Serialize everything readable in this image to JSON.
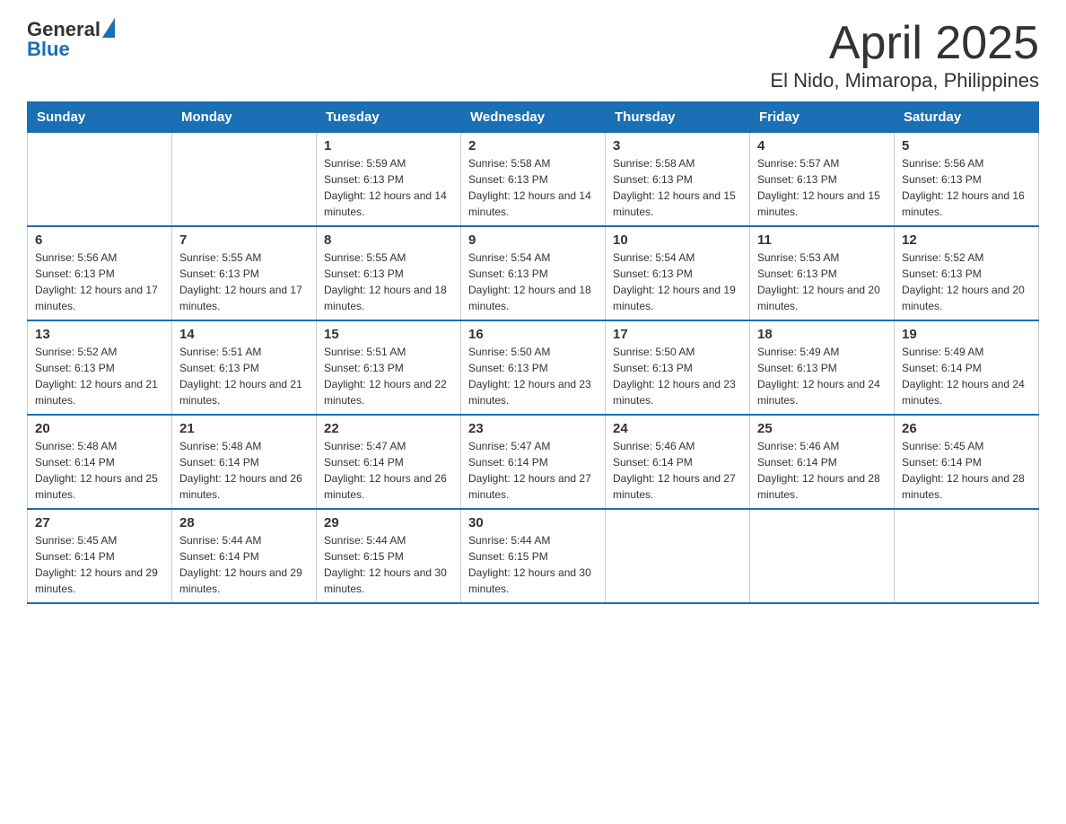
{
  "header": {
    "logo": {
      "general": "General",
      "blue": "Blue"
    },
    "title": "April 2025",
    "subtitle": "El Nido, Mimaropa, Philippines"
  },
  "weekdays": [
    "Sunday",
    "Monday",
    "Tuesday",
    "Wednesday",
    "Thursday",
    "Friday",
    "Saturday"
  ],
  "weeks": [
    [
      {
        "day": "",
        "sunrise": "",
        "sunset": "",
        "daylight": ""
      },
      {
        "day": "",
        "sunrise": "",
        "sunset": "",
        "daylight": ""
      },
      {
        "day": "1",
        "sunrise": "Sunrise: 5:59 AM",
        "sunset": "Sunset: 6:13 PM",
        "daylight": "Daylight: 12 hours and 14 minutes."
      },
      {
        "day": "2",
        "sunrise": "Sunrise: 5:58 AM",
        "sunset": "Sunset: 6:13 PM",
        "daylight": "Daylight: 12 hours and 14 minutes."
      },
      {
        "day": "3",
        "sunrise": "Sunrise: 5:58 AM",
        "sunset": "Sunset: 6:13 PM",
        "daylight": "Daylight: 12 hours and 15 minutes."
      },
      {
        "day": "4",
        "sunrise": "Sunrise: 5:57 AM",
        "sunset": "Sunset: 6:13 PM",
        "daylight": "Daylight: 12 hours and 15 minutes."
      },
      {
        "day": "5",
        "sunrise": "Sunrise: 5:56 AM",
        "sunset": "Sunset: 6:13 PM",
        "daylight": "Daylight: 12 hours and 16 minutes."
      }
    ],
    [
      {
        "day": "6",
        "sunrise": "Sunrise: 5:56 AM",
        "sunset": "Sunset: 6:13 PM",
        "daylight": "Daylight: 12 hours and 17 minutes."
      },
      {
        "day": "7",
        "sunrise": "Sunrise: 5:55 AM",
        "sunset": "Sunset: 6:13 PM",
        "daylight": "Daylight: 12 hours and 17 minutes."
      },
      {
        "day": "8",
        "sunrise": "Sunrise: 5:55 AM",
        "sunset": "Sunset: 6:13 PM",
        "daylight": "Daylight: 12 hours and 18 minutes."
      },
      {
        "day": "9",
        "sunrise": "Sunrise: 5:54 AM",
        "sunset": "Sunset: 6:13 PM",
        "daylight": "Daylight: 12 hours and 18 minutes."
      },
      {
        "day": "10",
        "sunrise": "Sunrise: 5:54 AM",
        "sunset": "Sunset: 6:13 PM",
        "daylight": "Daylight: 12 hours and 19 minutes."
      },
      {
        "day": "11",
        "sunrise": "Sunrise: 5:53 AM",
        "sunset": "Sunset: 6:13 PM",
        "daylight": "Daylight: 12 hours and 20 minutes."
      },
      {
        "day": "12",
        "sunrise": "Sunrise: 5:52 AM",
        "sunset": "Sunset: 6:13 PM",
        "daylight": "Daylight: 12 hours and 20 minutes."
      }
    ],
    [
      {
        "day": "13",
        "sunrise": "Sunrise: 5:52 AM",
        "sunset": "Sunset: 6:13 PM",
        "daylight": "Daylight: 12 hours and 21 minutes."
      },
      {
        "day": "14",
        "sunrise": "Sunrise: 5:51 AM",
        "sunset": "Sunset: 6:13 PM",
        "daylight": "Daylight: 12 hours and 21 minutes."
      },
      {
        "day": "15",
        "sunrise": "Sunrise: 5:51 AM",
        "sunset": "Sunset: 6:13 PM",
        "daylight": "Daylight: 12 hours and 22 minutes."
      },
      {
        "day": "16",
        "sunrise": "Sunrise: 5:50 AM",
        "sunset": "Sunset: 6:13 PM",
        "daylight": "Daylight: 12 hours and 23 minutes."
      },
      {
        "day": "17",
        "sunrise": "Sunrise: 5:50 AM",
        "sunset": "Sunset: 6:13 PM",
        "daylight": "Daylight: 12 hours and 23 minutes."
      },
      {
        "day": "18",
        "sunrise": "Sunrise: 5:49 AM",
        "sunset": "Sunset: 6:13 PM",
        "daylight": "Daylight: 12 hours and 24 minutes."
      },
      {
        "day": "19",
        "sunrise": "Sunrise: 5:49 AM",
        "sunset": "Sunset: 6:14 PM",
        "daylight": "Daylight: 12 hours and 24 minutes."
      }
    ],
    [
      {
        "day": "20",
        "sunrise": "Sunrise: 5:48 AM",
        "sunset": "Sunset: 6:14 PM",
        "daylight": "Daylight: 12 hours and 25 minutes."
      },
      {
        "day": "21",
        "sunrise": "Sunrise: 5:48 AM",
        "sunset": "Sunset: 6:14 PM",
        "daylight": "Daylight: 12 hours and 26 minutes."
      },
      {
        "day": "22",
        "sunrise": "Sunrise: 5:47 AM",
        "sunset": "Sunset: 6:14 PM",
        "daylight": "Daylight: 12 hours and 26 minutes."
      },
      {
        "day": "23",
        "sunrise": "Sunrise: 5:47 AM",
        "sunset": "Sunset: 6:14 PM",
        "daylight": "Daylight: 12 hours and 27 minutes."
      },
      {
        "day": "24",
        "sunrise": "Sunrise: 5:46 AM",
        "sunset": "Sunset: 6:14 PM",
        "daylight": "Daylight: 12 hours and 27 minutes."
      },
      {
        "day": "25",
        "sunrise": "Sunrise: 5:46 AM",
        "sunset": "Sunset: 6:14 PM",
        "daylight": "Daylight: 12 hours and 28 minutes."
      },
      {
        "day": "26",
        "sunrise": "Sunrise: 5:45 AM",
        "sunset": "Sunset: 6:14 PM",
        "daylight": "Daylight: 12 hours and 28 minutes."
      }
    ],
    [
      {
        "day": "27",
        "sunrise": "Sunrise: 5:45 AM",
        "sunset": "Sunset: 6:14 PM",
        "daylight": "Daylight: 12 hours and 29 minutes."
      },
      {
        "day": "28",
        "sunrise": "Sunrise: 5:44 AM",
        "sunset": "Sunset: 6:14 PM",
        "daylight": "Daylight: 12 hours and 29 minutes."
      },
      {
        "day": "29",
        "sunrise": "Sunrise: 5:44 AM",
        "sunset": "Sunset: 6:15 PM",
        "daylight": "Daylight: 12 hours and 30 minutes."
      },
      {
        "day": "30",
        "sunrise": "Sunrise: 5:44 AM",
        "sunset": "Sunset: 6:15 PM",
        "daylight": "Daylight: 12 hours and 30 minutes."
      },
      {
        "day": "",
        "sunrise": "",
        "sunset": "",
        "daylight": ""
      },
      {
        "day": "",
        "sunrise": "",
        "sunset": "",
        "daylight": ""
      },
      {
        "day": "",
        "sunrise": "",
        "sunset": "",
        "daylight": ""
      }
    ]
  ]
}
